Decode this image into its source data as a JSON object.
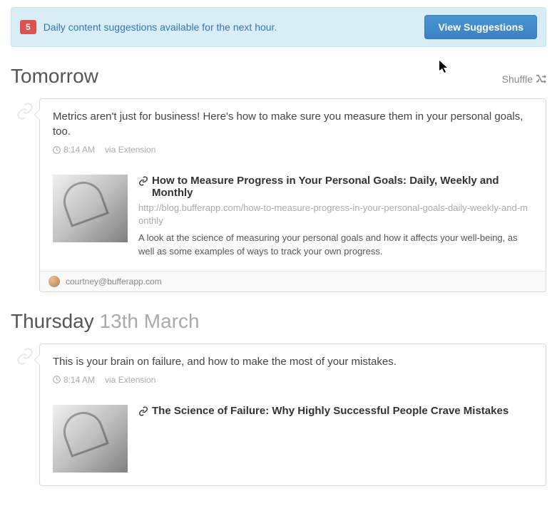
{
  "alert": {
    "count": "5",
    "text": "Daily content suggestions available for the next hour.",
    "button": "View Suggestions"
  },
  "shuffle_label": "Shuffle",
  "days": [
    {
      "label_main": "Tomorrow",
      "label_sub": "",
      "posts": [
        {
          "text": "Metrics aren't just for business! Here's how to make sure you measure them in your personal goals, too.",
          "time": "8:14 AM",
          "via": "via Extension",
          "link_title": "How to Measure Progress in Your Personal Goals: Daily, Weekly and Monthly",
          "link_url": "http://blog.bufferapp.com/how-to-measure-progress-in-your-personal-goals-daily-weekly-and-monthly",
          "link_desc": "A look at the science of measuring your personal goals and how it affects your well-being, as well as some examples of ways to track your own progress.",
          "author": "courtney@bufferapp.com"
        }
      ]
    },
    {
      "label_main": "Thursday ",
      "label_sub": "13th March",
      "posts": [
        {
          "text": "This is your brain on failure, and how to make the most of your mistakes.",
          "time": "8:14 AM",
          "via": "via Extension",
          "link_title": "The Science of Failure: Why Highly Successful People Crave Mistakes",
          "link_url": "",
          "link_desc": "",
          "author": ""
        }
      ]
    }
  ]
}
